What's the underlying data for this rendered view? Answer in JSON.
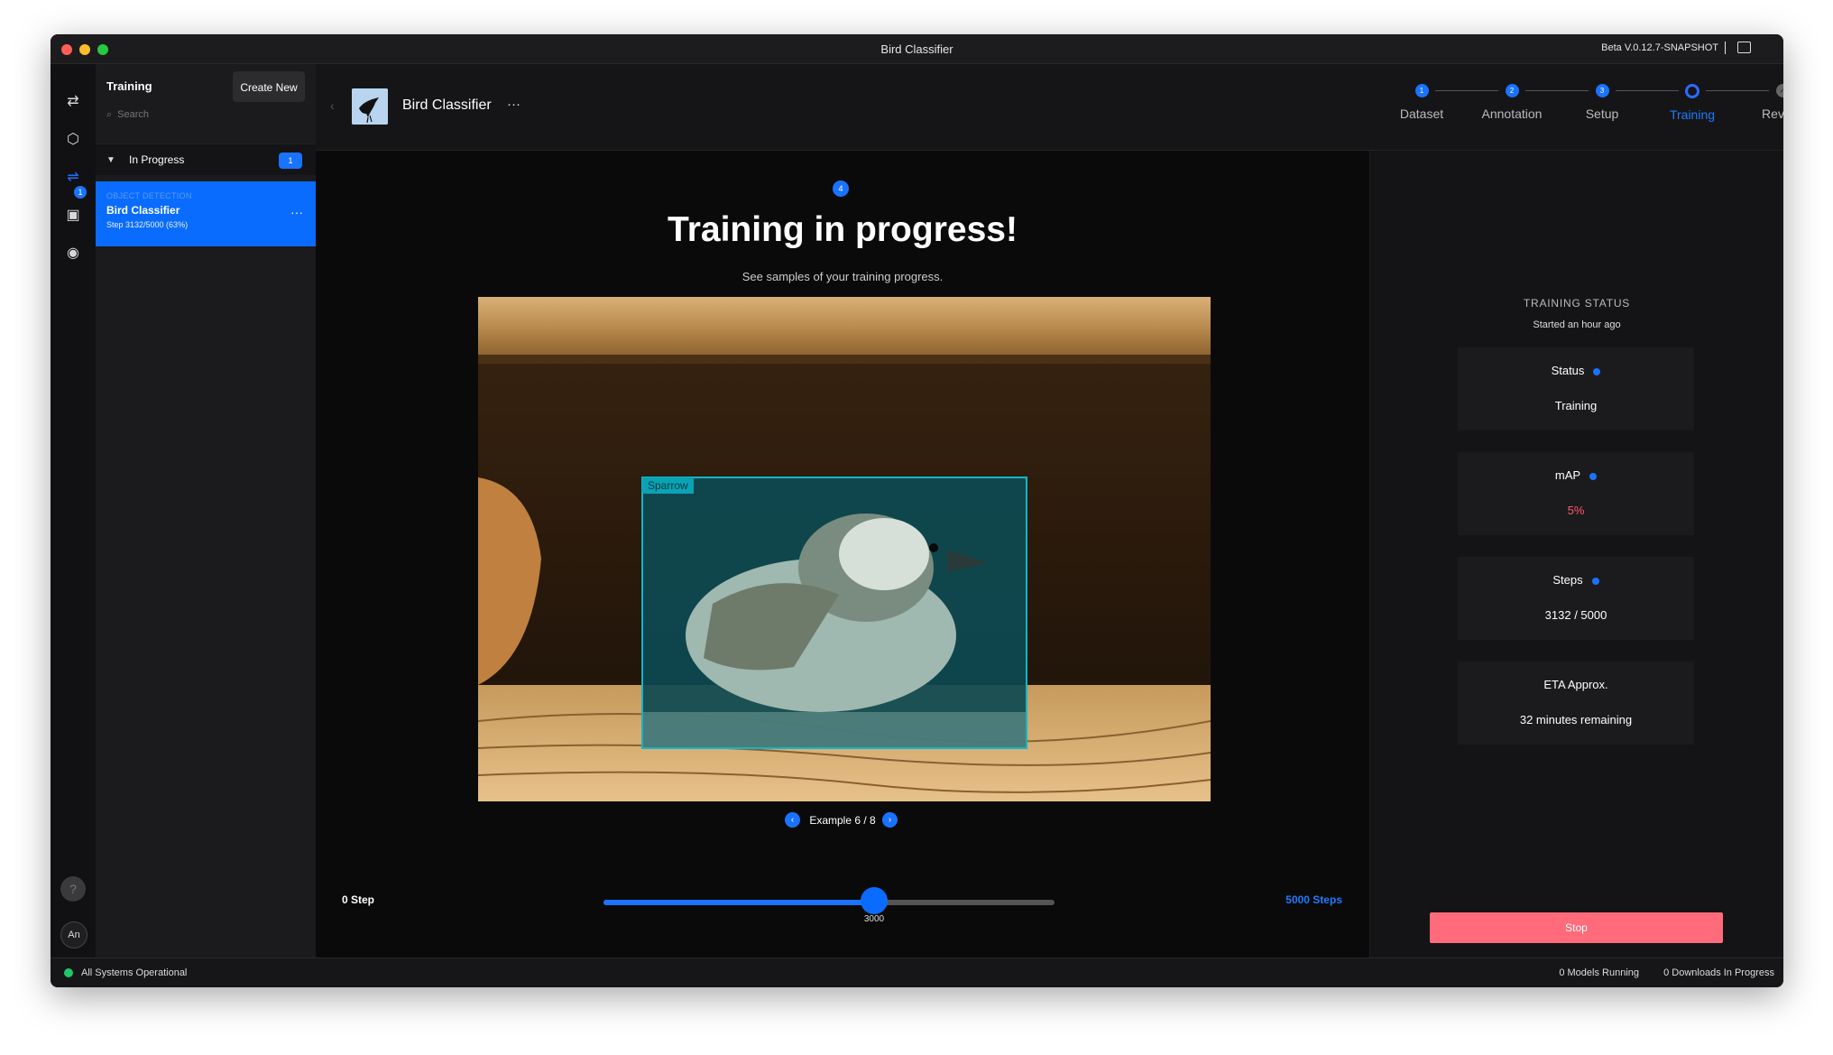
{
  "window": {
    "title": "Bird Classifier",
    "version": "Beta V.0.12.7-SNAPSHOT",
    "traffic_colors": [
      "#ff5f57",
      "#febc2e",
      "#28c840"
    ]
  },
  "rail": {
    "badge": "1",
    "help_label": "?",
    "avatar_initials": "An"
  },
  "sidebar": {
    "title": "Training",
    "create_label": "Create New",
    "search_placeholder": "Search",
    "section_label": "In Progress",
    "section_count": "1",
    "item": {
      "subtitle": "OBJECT DETECTION",
      "name": "Bird Classifier",
      "step": "Step 3132/5000 (63%)"
    }
  },
  "header": {
    "project_name": "Bird Classifier",
    "more": "···",
    "steps": [
      {
        "num": "1",
        "label": "Dataset",
        "state": "complete"
      },
      {
        "num": "2",
        "label": "Annotation",
        "state": "complete"
      },
      {
        "num": "3",
        "label": "Setup",
        "state": "complete"
      },
      {
        "num": "",
        "label": "Training",
        "state": "active"
      },
      {
        "num": "✓",
        "label": "Review",
        "state": "pending"
      }
    ]
  },
  "content": {
    "step_number": "4",
    "heading": "Training in progress!",
    "subheading": "See samples of your training progress.",
    "detection_label": "Sparrow",
    "example_text": "Example 6 / 8",
    "slider": {
      "min_label": "0 Step",
      "max_label": "5000 Steps",
      "value": 3000,
      "max": 5000,
      "value_label": "3000"
    }
  },
  "panel": {
    "title": "TRAINING STATUS",
    "subtitle": "Started an hour ago",
    "cards": [
      {
        "label": "Status",
        "value": "Training",
        "info": true,
        "alert": false
      },
      {
        "label": "mAP",
        "value": "5%",
        "info": true,
        "alert": true
      },
      {
        "label": "Steps",
        "value": "3132 / 5000",
        "info": true,
        "alert": false
      },
      {
        "label": "ETA Approx.",
        "value": "32 minutes remaining",
        "info": false,
        "alert": false
      }
    ],
    "stop_label": "Stop"
  },
  "statusbar": {
    "system": "All Systems Operational",
    "models": "0 Models Running",
    "downloads": "0 Downloads In Progress"
  }
}
